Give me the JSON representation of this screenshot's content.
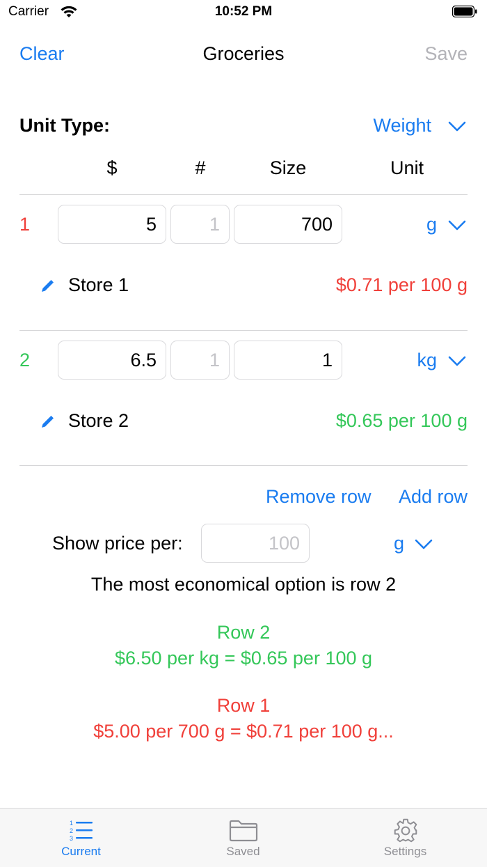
{
  "status_bar": {
    "carrier": "Carrier",
    "time": "10:52 PM"
  },
  "nav": {
    "clear_label": "Clear",
    "title": "Groceries",
    "save_label": "Save"
  },
  "unit_type": {
    "label": "Unit Type:",
    "value": "Weight"
  },
  "columns": {
    "price": "$",
    "count": "#",
    "size": "Size",
    "unit": "Unit"
  },
  "rows": [
    {
      "number": "1",
      "price": "5",
      "count_placeholder": "1",
      "size": "700",
      "unit": "g",
      "store": "Store 1",
      "per_price": "$0.71 per 100 g",
      "color": "#f0403a"
    },
    {
      "number": "2",
      "price": "6.5",
      "count_placeholder": "1",
      "size": "1",
      "unit": "kg",
      "store": "Store 2",
      "per_price": "$0.65 per 100 g",
      "color": "#34c759"
    }
  ],
  "actions": {
    "remove_row": "Remove row",
    "add_row": "Add row"
  },
  "show_price": {
    "label": "Show price per:",
    "placeholder": "100",
    "unit": "g"
  },
  "result": {
    "headline": "The most economical option is row 2",
    "best": {
      "title": "Row 2",
      "detail": "$6.50 per kg = $0.65 per 100 g"
    },
    "other": {
      "title": "Row 1",
      "detail": "$5.00 per 700 g = $0.71 per 100 g..."
    }
  },
  "tabs": [
    {
      "label": "Current",
      "icon": "numbered-list-icon",
      "active": true
    },
    {
      "label": "Saved",
      "icon": "folder-icon",
      "active": false
    },
    {
      "label": "Settings",
      "icon": "gear-icon",
      "active": false
    }
  ],
  "colors": {
    "accent": "#1a7cf0",
    "worse": "#f0403a",
    "better": "#34c759",
    "inactive_tab": "#8e8e93"
  }
}
